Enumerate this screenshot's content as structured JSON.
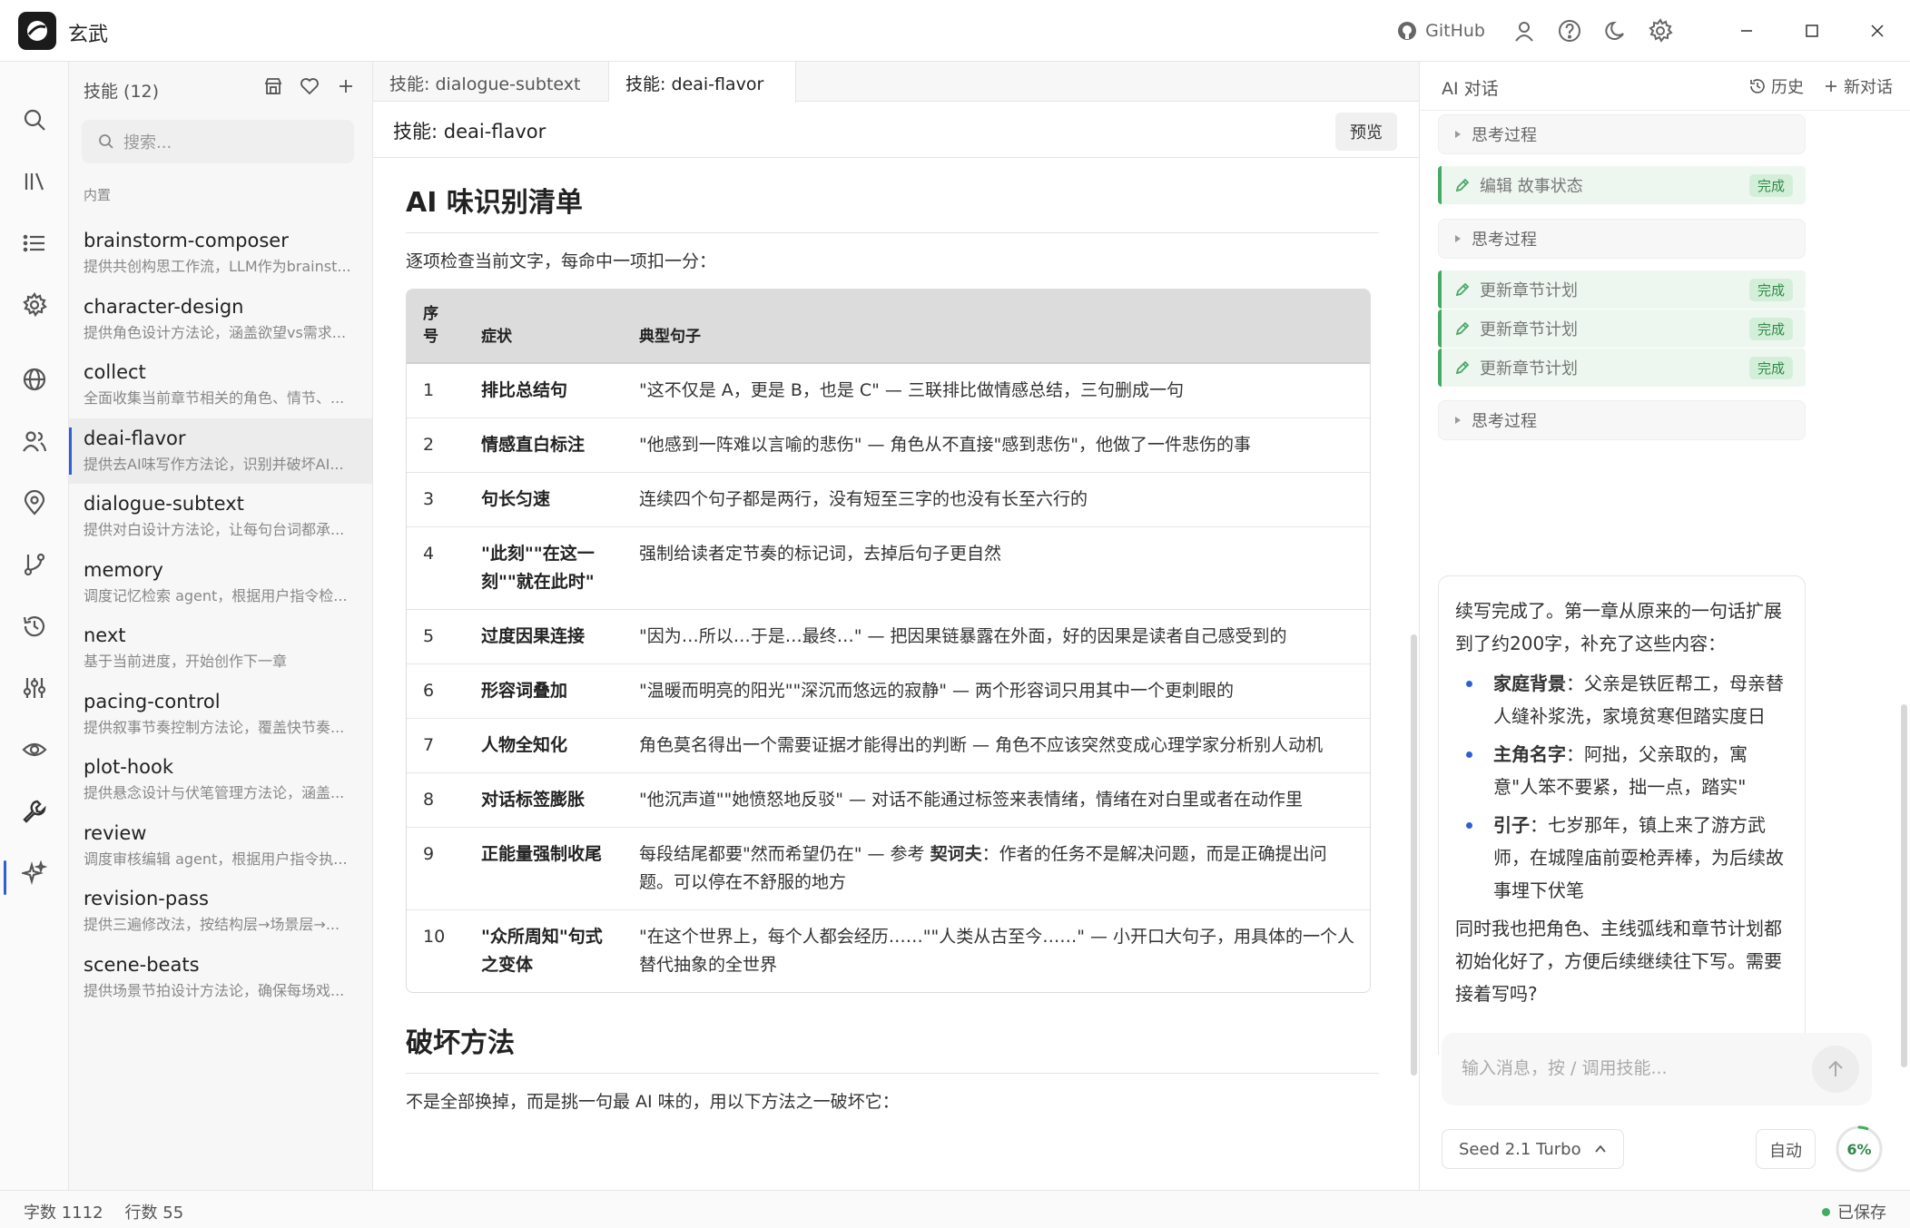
{
  "app": {
    "title": "玄武"
  },
  "titlebar": {
    "github_label": "GitHub"
  },
  "skills_panel": {
    "header": "技能 (12)",
    "search_placeholder": "搜索...",
    "section_label": "内置",
    "items": [
      {
        "name": "brainstorm-composer",
        "desc": "提供共创构思工作流，LLM作为brainst..."
      },
      {
        "name": "character-design",
        "desc": "提供角色设计方法论，涵盖欲望vs需求..."
      },
      {
        "name": "collect",
        "desc": "全面收集当前章节相关的角色、情节、..."
      },
      {
        "name": "deai-flavor",
        "desc": "提供去AI味写作方法论，识别并破坏AI..."
      },
      {
        "name": "dialogue-subtext",
        "desc": "提供对白设计方法论，让每句台词都承..."
      },
      {
        "name": "memory",
        "desc": "调度记忆检索 agent，根据用户指令检..."
      },
      {
        "name": "next",
        "desc": "基于当前进度，开始创作下一章"
      },
      {
        "name": "pacing-control",
        "desc": "提供叙事节奏控制方法论，覆盖快节奏..."
      },
      {
        "name": "plot-hook",
        "desc": "提供悬念设计与伏笔管理方法论，涵盖..."
      },
      {
        "name": "review",
        "desc": "调度审核编辑 agent，根据用户指令执..."
      },
      {
        "name": "revision-pass",
        "desc": "提供三遍修改法，按结构层→场景层→..."
      },
      {
        "name": "scene-beats",
        "desc": "提供场景节拍设计方法论，确保每场戏..."
      }
    ]
  },
  "editor": {
    "tabs": [
      "技能: dialogue-subtext",
      "技能: deai-flavor"
    ],
    "doc_title": "技能: deai-flavor",
    "preview_label": "预览",
    "heading1": "AI 味识别清单",
    "intro": "逐项检查当前文字，每命中一项扣一分：",
    "table": {
      "headers": [
        "序号",
        "症状",
        "典型句子"
      ],
      "rows": [
        {
          "no": "1",
          "symptom": "排比总结句",
          "example": "\"这不仅是 A，更是 B，也是 C\" — 三联排比做情感总结，三句删成一句"
        },
        {
          "no": "2",
          "symptom": "情感直白标注",
          "example": "\"他感到一阵难以言喻的悲伤\" — 角色从不直接\"感到悲伤\"，他做了一件悲伤的事"
        },
        {
          "no": "3",
          "symptom": "句长匀速",
          "example": "连续四个句子都是两行，没有短至三字的也没有长至六行的"
        },
        {
          "no": "4",
          "symptom": "\"此刻\"\"在这一刻\"\"就在此时\"",
          "example": "强制给读者定节奏的标记词，去掉后句子更自然"
        },
        {
          "no": "5",
          "symptom": "过度因果连接",
          "example": "\"因为…所以…于是…最终…\" — 把因果链暴露在外面，好的因果是读者自己感受到的"
        },
        {
          "no": "6",
          "symptom": "形容词叠加",
          "example": "\"温暖而明亮的阳光\"\"深沉而悠远的寂静\" — 两个形容词只用其中一个更刺眼的"
        },
        {
          "no": "7",
          "symptom": "人物全知化",
          "example": "角色莫名得出一个需要证据才能得出的判断 — 角色不应该突然变成心理学家分析别人动机"
        },
        {
          "no": "8",
          "symptom": "对话标签膨胀",
          "example": "\"他沉声道\"\"她愤怒地反驳\" — 对话不能通过标签来表情绪，情绪在对白里或者在动作里"
        },
        {
          "no": "9",
          "symptom": "正能量强制收尾",
          "example_pre": "每段结尾都要\"然而希望仍在\" — 参考 ",
          "example_bold": "契诃夫",
          "example_post": "：作者的任务不是解决问题，而是正确提出问题。可以停在不舒服的地方"
        },
        {
          "no": "10",
          "symptom": "\"众所周知\"句式之变体",
          "example": "\"在这个世界上，每个人都会经历……\"\"人类从古至今……\" — 小开口大句子，用具体的一个人替代抽象的全世界"
        }
      ]
    },
    "heading2": "破坏方法",
    "outro": "不是全部换掉，而是挑一句最 AI 味的，用以下方法之一破坏它："
  },
  "chat": {
    "title": "AI 对话",
    "history_label": "历史",
    "new_label": "新对话",
    "events": [
      {
        "type": "think",
        "label": "思考过程"
      },
      {
        "type": "tool",
        "label": "编辑 故事状态",
        "status": "完成"
      },
      {
        "type": "think",
        "label": "思考过程"
      },
      {
        "type": "tool",
        "label": "更新章节计划",
        "status": "完成"
      },
      {
        "type": "tool",
        "label": "更新章节计划",
        "status": "完成"
      },
      {
        "type": "tool",
        "label": "更新章节计划",
        "status": "完成"
      },
      {
        "type": "think",
        "label": "思考过程"
      }
    ],
    "reply": {
      "intro": "续写完成了。第一章从原来的一句话扩展到了约200字，补充了这些内容：",
      "bullets": [
        {
          "bold": "家庭背景",
          "text": "：父亲是铁匠帮工，母亲替人缝补浆洗，家境贫寒但踏实度日"
        },
        {
          "bold": "主角名字",
          "text": "：阿拙，父亲取的，寓意\"人笨不要紧，拙一点，踏实\""
        },
        {
          "bold": "引子",
          "text": "：七岁那年，镇上来了游方武师，在城隍庙前耍枪弄棒，为后续故事埋下伏笔"
        }
      ],
      "outro": "同时我也把角色、主线弧线和章节计划都初始化好了，方便后续继续往下写。需要接着写吗?"
    },
    "input_placeholder": "输入消息，按 / 调用技能...",
    "model_label": "Seed 2.1 Turbo",
    "auto_label": "自动",
    "context_percent": "6%",
    "context_fraction": 0.06
  },
  "statusbar": {
    "word_count": "字数 1112",
    "line_count": "行数 55",
    "saved_label": "已保存"
  },
  "colors": {
    "accent": "#2c5fd8",
    "success": "#3fae5f",
    "success_bg": "#eef7ef"
  }
}
